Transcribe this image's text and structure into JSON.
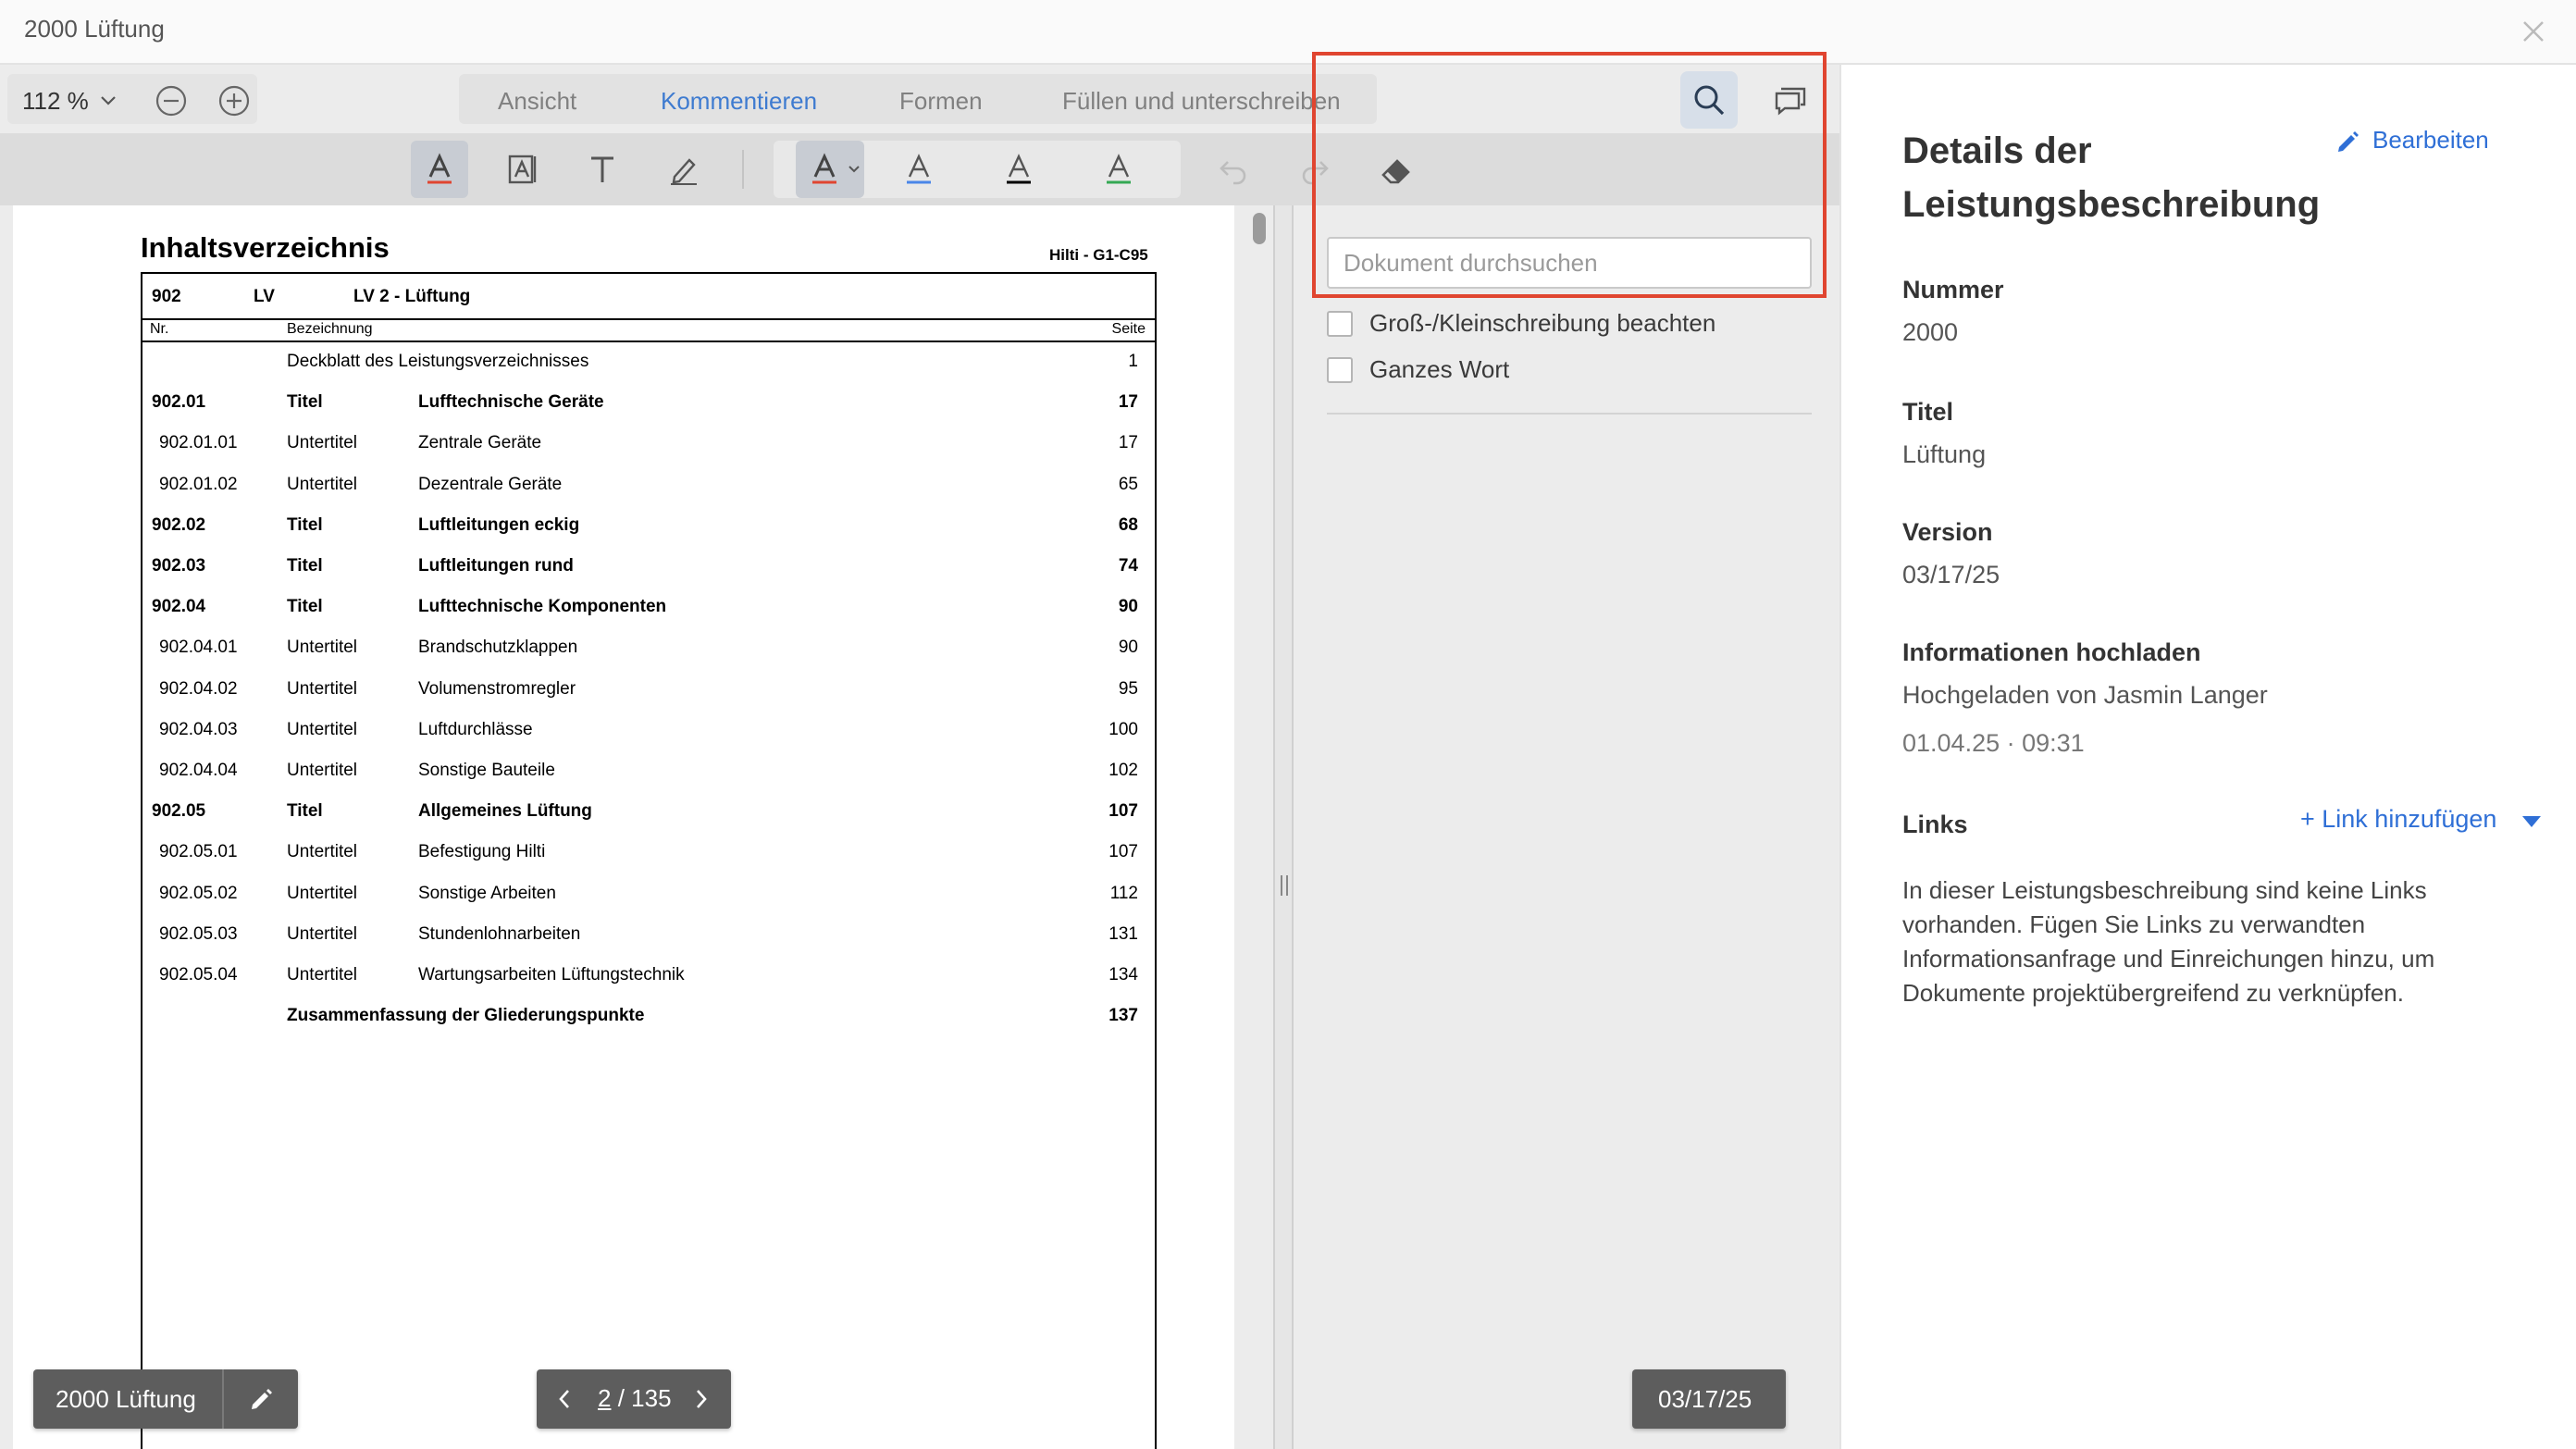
{
  "window": {
    "title": "2000 Lüftung"
  },
  "zoom": {
    "value": "112 %"
  },
  "tabs": [
    "Ansicht",
    "Kommentieren",
    "Formen",
    "Füllen und unterschreiben"
  ],
  "active_tab": "Kommentieren",
  "colors": {
    "accent": "#3e7bd0",
    "link": "#2f6fd6",
    "highlight": "#e04530",
    "underline_red": "#e04530",
    "underline_blue": "#4a86e8",
    "underline_black": "#000000",
    "underline_green": "#34a853"
  },
  "document": {
    "heading": "Inhaltsverzeichnis",
    "code": "Hilti - G1-C95",
    "head": {
      "num": "902",
      "type": "LV",
      "title": "LV 2 - Lüftung"
    },
    "columns": {
      "nr": "Nr.",
      "bez": "Bezeichnung",
      "seite": "Seite"
    },
    "rows": [
      {
        "nr": "",
        "type": "",
        "title": "Deckblatt des Leistungsverzeichnisses",
        "page": "1",
        "bold": false
      },
      {
        "nr": "902.01",
        "type": "Titel",
        "title": "Lufftechnische Geräte",
        "page": "17",
        "bold": true
      },
      {
        "nr": "902.01.01",
        "type": "Untertitel",
        "title": "Zentrale Geräte",
        "page": "17",
        "bold": false
      },
      {
        "nr": "902.01.02",
        "type": "Untertitel",
        "title": "Dezentrale Geräte",
        "page": "65",
        "bold": false
      },
      {
        "nr": "902.02",
        "type": "Titel",
        "title": "Luftleitungen eckig",
        "page": "68",
        "bold": true
      },
      {
        "nr": "902.03",
        "type": "Titel",
        "title": "Luftleitungen rund",
        "page": "74",
        "bold": true
      },
      {
        "nr": "902.04",
        "type": "Titel",
        "title": "Lufttechnische Komponenten",
        "page": "90",
        "bold": true
      },
      {
        "nr": "902.04.01",
        "type": "Untertitel",
        "title": "Brandschutzklappen",
        "page": "90",
        "bold": false
      },
      {
        "nr": "902.04.02",
        "type": "Untertitel",
        "title": "Volumenstromregler",
        "page": "95",
        "bold": false
      },
      {
        "nr": "902.04.03",
        "type": "Untertitel",
        "title": "Luftdurchlässe",
        "page": "100",
        "bold": false
      },
      {
        "nr": "902.04.04",
        "type": "Untertitel",
        "title": "Sonstige Bauteile",
        "page": "102",
        "bold": false
      },
      {
        "nr": "902.05",
        "type": "Titel",
        "title": "Allgemeines Lüftung",
        "page": "107",
        "bold": true
      },
      {
        "nr": "902.05.01",
        "type": "Untertitel",
        "title": "Befestigung Hilti",
        "page": "107",
        "bold": false
      },
      {
        "nr": "902.05.02",
        "type": "Untertitel",
        "title": "Sonstige Arbeiten",
        "page": "112",
        "bold": false
      },
      {
        "nr": "902.05.03",
        "type": "Untertitel",
        "title": "Stundenlohnarbeiten",
        "page": "131",
        "bold": false
      },
      {
        "nr": "902.05.04",
        "type": "Untertitel",
        "title": "Wartungsarbeiten Lüftungstechnik",
        "page": "134",
        "bold": false
      },
      {
        "nr": "",
        "type": "",
        "title": "Zusammenfassung der Gliederungspunkte",
        "page": "137",
        "bold": true
      }
    ]
  },
  "search": {
    "placeholder": "Dokument durchsuchen",
    "value": "",
    "case_label": "Groß-/Kleinschreibung beachten",
    "word_label": "Ganzes Wort"
  },
  "footer": {
    "doc_name": "2000 Lüftung",
    "current_page": "2",
    "total_pages": "/ 135",
    "version": "03/17/25"
  },
  "details": {
    "title": "Details der Leistungsbeschreibung",
    "edit_label": "Bearbeiten",
    "number_label": "Nummer",
    "number_value": "2000",
    "title_label": "Titel",
    "title_value": "Lüftung",
    "version_label": "Version",
    "version_value": "03/17/25",
    "upload_label": "Informationen hochladen",
    "upload_by": "Hochgeladen von Jasmin Langer",
    "upload_when": "01.04.25 · 09:31",
    "links_label": "Links",
    "add_link_label": "+ Link hinzufügen",
    "links_empty": "In dieser Leistungsbeschreibung sind keine Links vorhanden. Fügen Sie Links zu verwandten Informationsanfrage und Einreichungen hinzu, um Dokumente projektübergreifend zu verknüpfen."
  }
}
